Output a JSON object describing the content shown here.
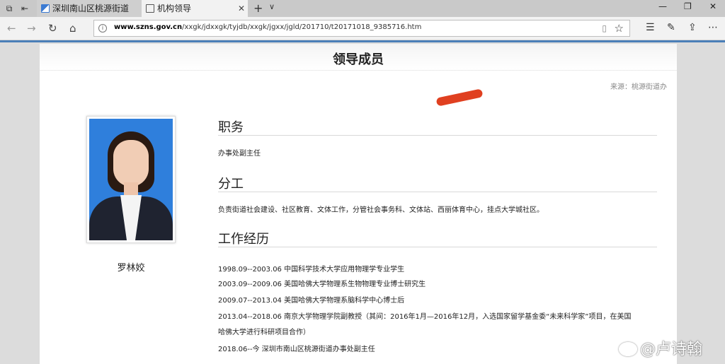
{
  "browser": {
    "tabs": [
      {
        "label": "深圳南山区桃源街道办事处",
        "active": false
      },
      {
        "label": "机构领导",
        "active": true
      }
    ],
    "url_domain": "www.szns.gov.cn",
    "url_path": "/xxgk/jdxxgk/tyjdb/xxgk/jgxx/jgld/201710/t20171018_9385716.htm",
    "new_tab_glyph": "+",
    "tab_menu_glyph": "∨"
  },
  "page": {
    "title": "领导成员",
    "source": "来源：桃源街道办",
    "person_name": "罗林姣",
    "sections": {
      "duty": {
        "title": "职务",
        "text": "办事处副主任"
      },
      "division": {
        "title": "分工",
        "text": "负责街道社会建设、社区教育、文体工作，分管社会事务科、文体站、西丽体育中心，挂点大学城社区。"
      },
      "experience": {
        "title": "工作经历",
        "items": [
          "1998.09--2003.06 中国科学技术大学应用物理学专业学生",
          "2003.09--2009.06 美国哈佛大学物理系生物物理专业博士研究生",
          "2009.07--2013.04 美国哈佛大学物理系脑科学中心博士后",
          "2013.04--2018.06 南京大学物理学院副教授（其间：2016年1月—2016年12月，入选国家留学基金委“未来科学家”项目，在美国",
          "哈佛大学进行科研项目合作）",
          "2018.06--今 深圳市南山区桃源街道办事处副主任"
        ]
      }
    }
  },
  "watermark": {
    "text": "卢诗翰",
    "prefix": "@"
  },
  "colors": {
    "photo_bg": "#2f7fdc",
    "accent_line": "#4b7fb8",
    "redaction": "#e04020"
  }
}
